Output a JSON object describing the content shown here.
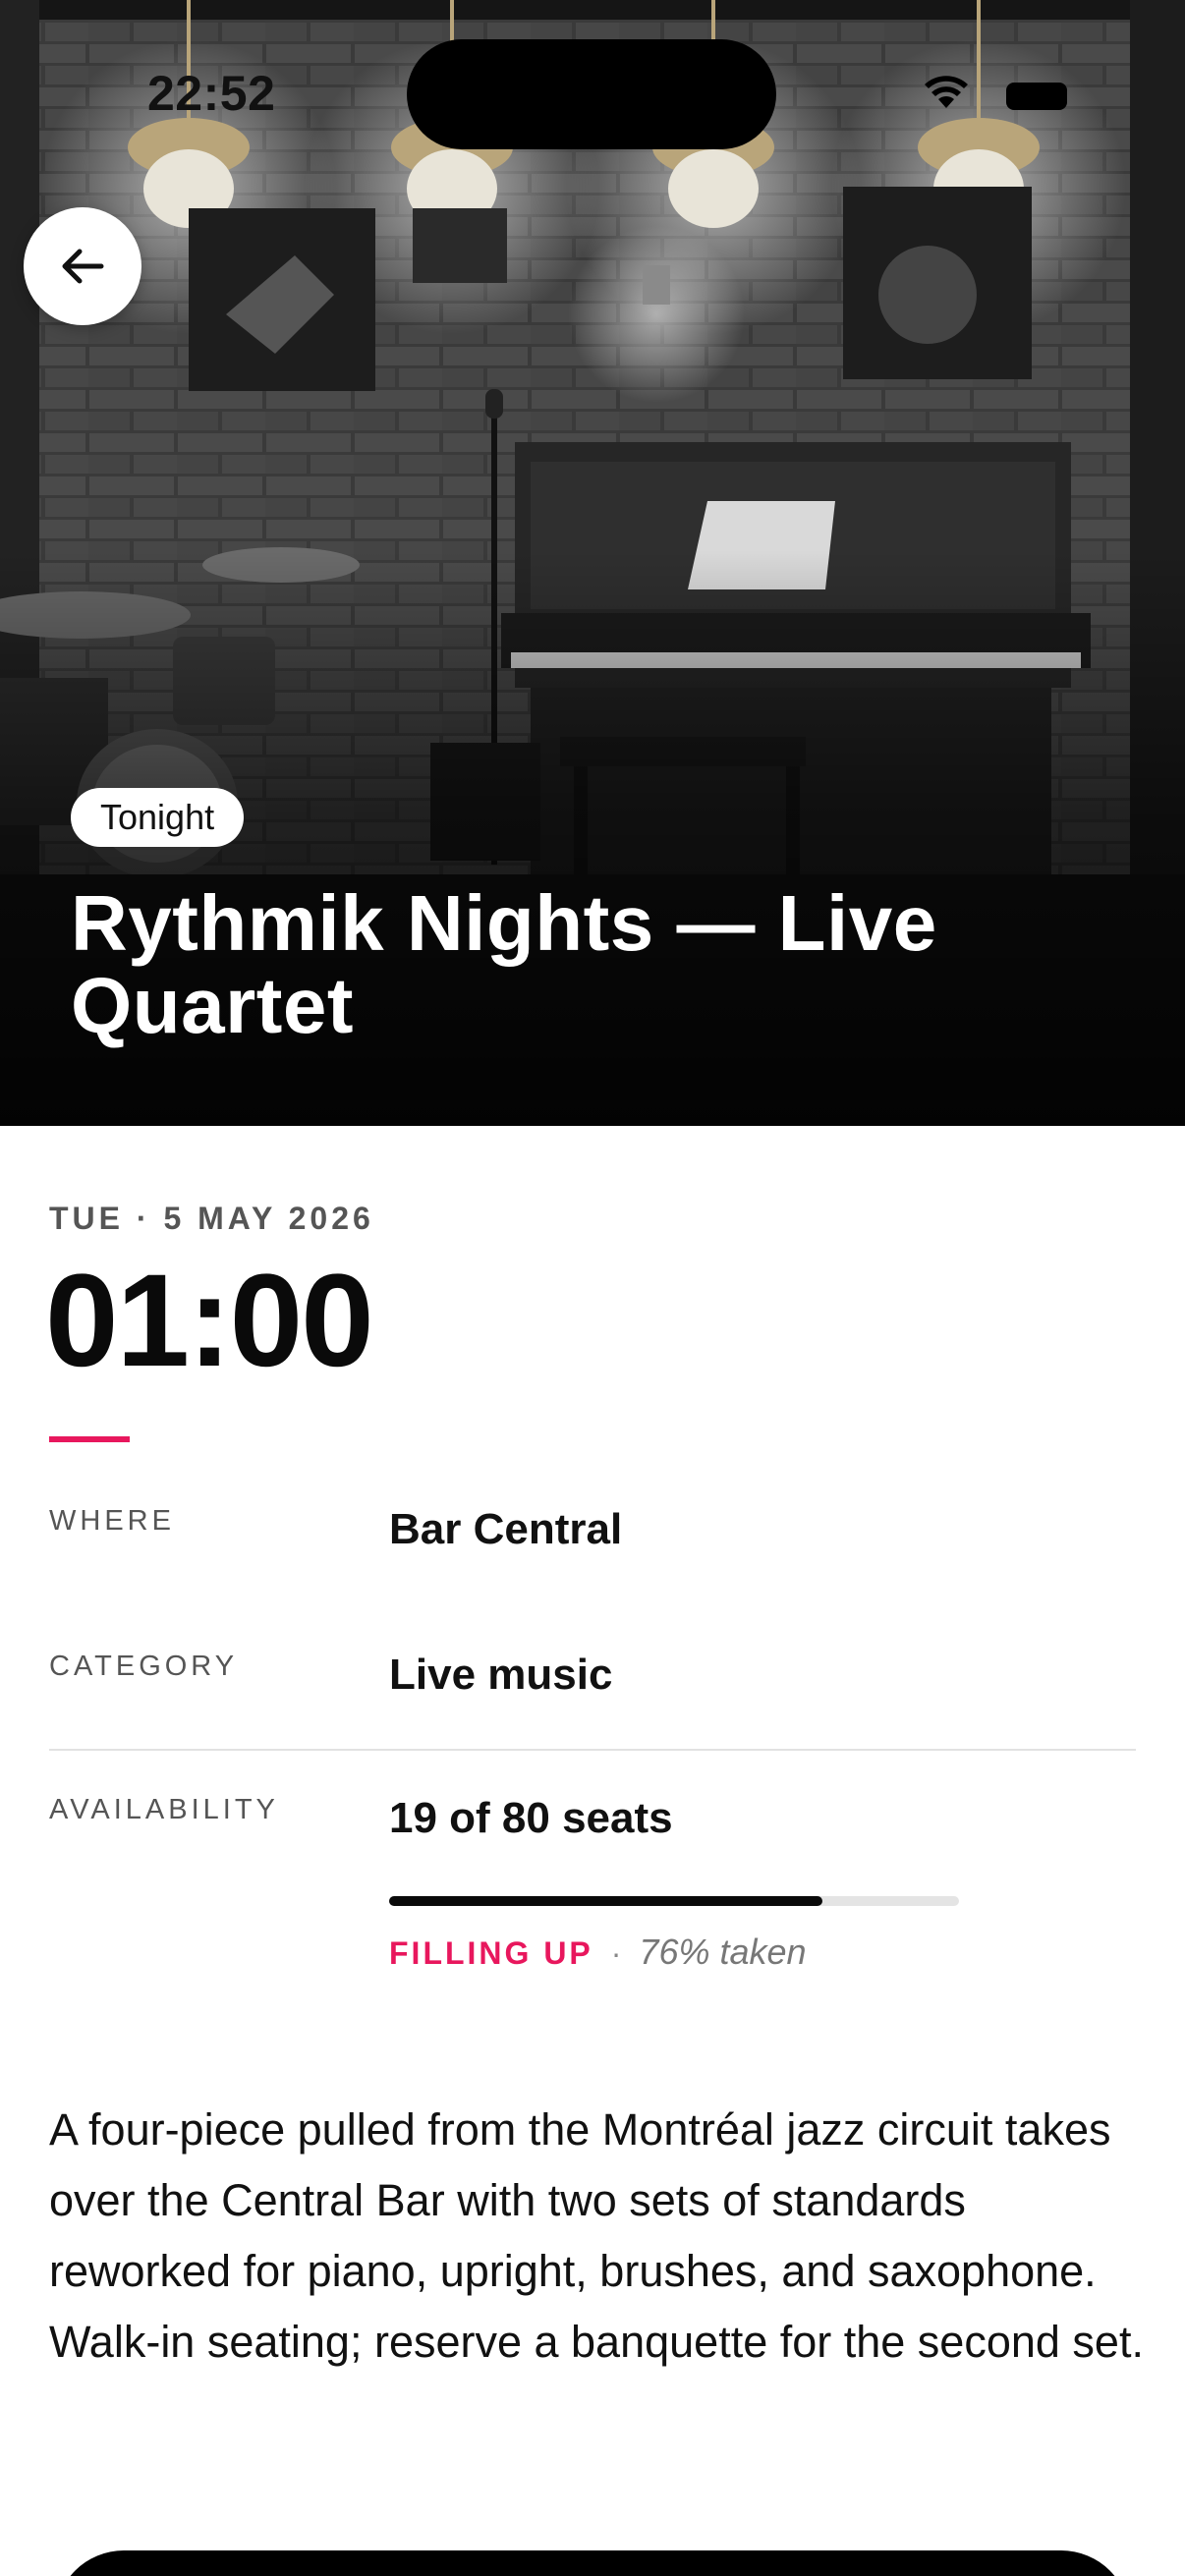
{
  "status_bar": {
    "time": "22:52"
  },
  "hero": {
    "badge": "Tonight",
    "title": "Rythmik Nights — Live Quartet"
  },
  "event": {
    "date": "TUE · 5 MAY 2026",
    "time": "01:00",
    "where_label": "WHERE",
    "where_value": "Bar Central",
    "category_label": "CATEGORY",
    "category_value": "Live music",
    "availability_label": "AVAILABILITY",
    "availability_value": "19 of 80 seats",
    "availability_fraction_taken": 0.76,
    "availability_status": "FILLING UP",
    "availability_separator": "·",
    "availability_taken": "76% taken"
  },
  "description": "A four-piece pulled from the Montréal jazz circuit takes over the Central Bar with two sets of standards reworked for piano, upright, brushes, and saxophone. Walk-in seating; reserve a banquette for the second set.",
  "colors": {
    "accent": "#e8175d",
    "hero_dark": "#2a2a2a"
  },
  "icons": {
    "back": "arrow-left-icon",
    "wifi": "wifi-icon",
    "battery": "battery-icon"
  }
}
